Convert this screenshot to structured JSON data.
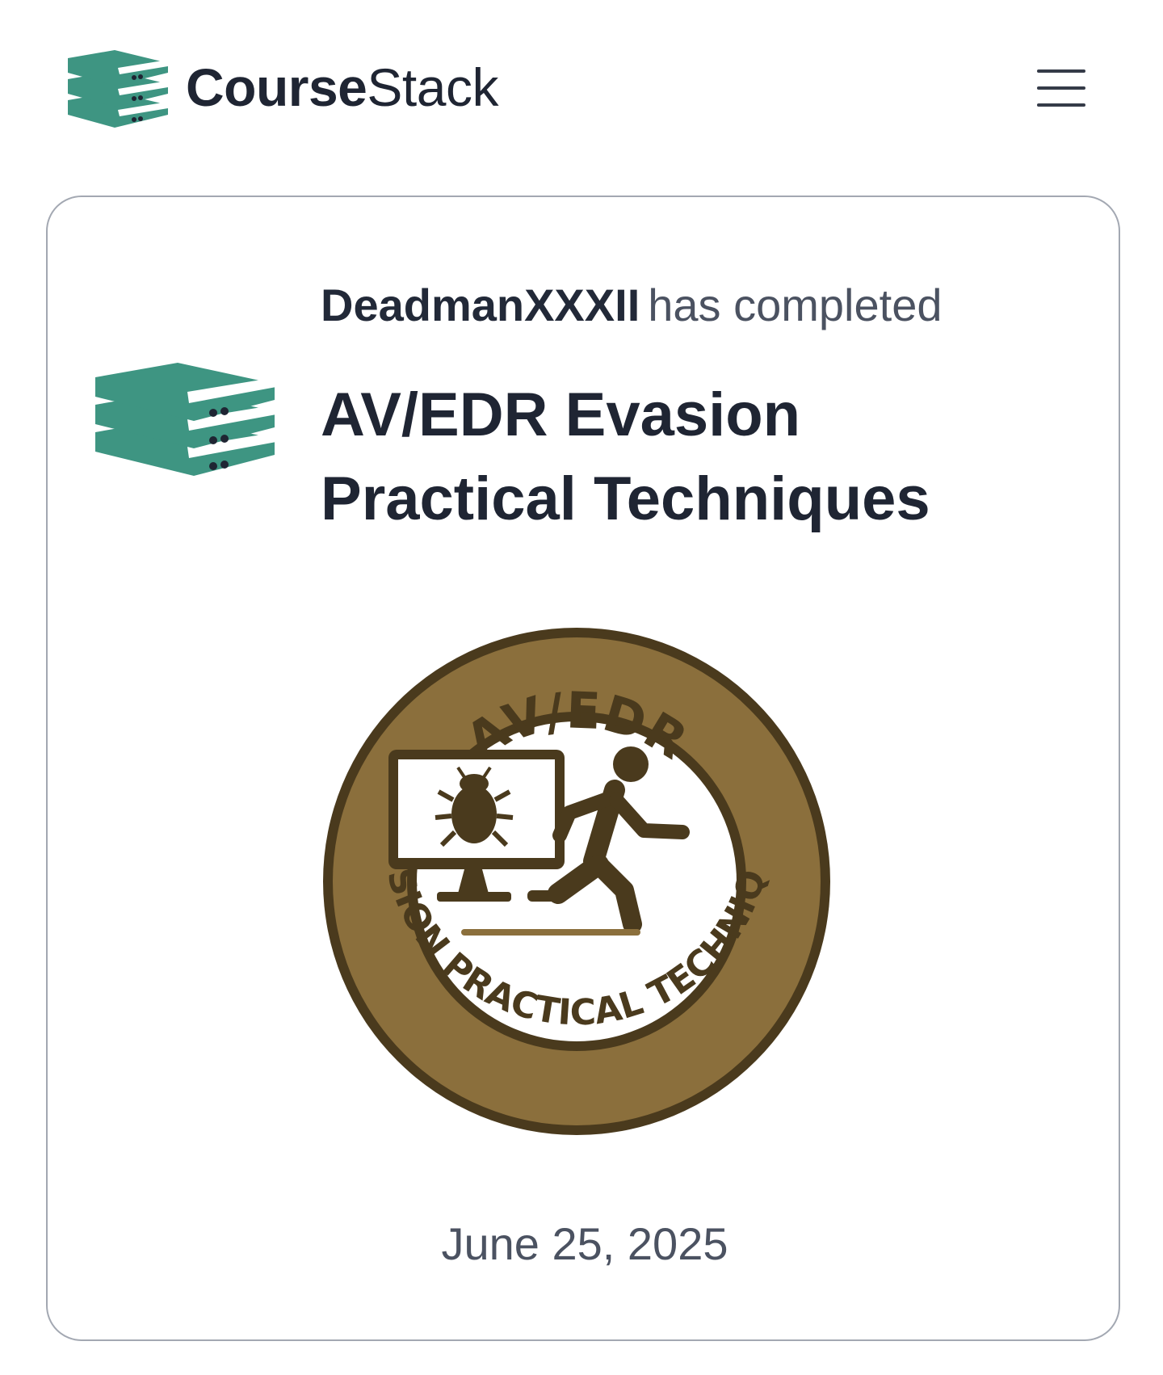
{
  "header": {
    "brand_bold": "Course",
    "brand_regular": "Stack",
    "menu_icon": "hamburger-menu-icon",
    "logo_icon": "stacked-books-icon"
  },
  "certificate": {
    "username": "DeadmanXXXII",
    "completed_text": "has completed",
    "course_title": "AV/EDR Evasion Practical Techniques",
    "date": "June 25, 2025",
    "badge": {
      "top_text": "AV/EDR",
      "bottom_text": "EVASION PRACTICAL TECHNIQUES",
      "icons": [
        "monitor-icon",
        "bug-icon",
        "running-person-icon"
      ]
    }
  },
  "colors": {
    "brand_teal": "#3e9582",
    "text_dark": "#1f2533",
    "text_muted": "#4b5261",
    "card_border": "#a3a8b2",
    "badge_gold": "#8b6f3c",
    "badge_dark": "#4a3a1d"
  }
}
